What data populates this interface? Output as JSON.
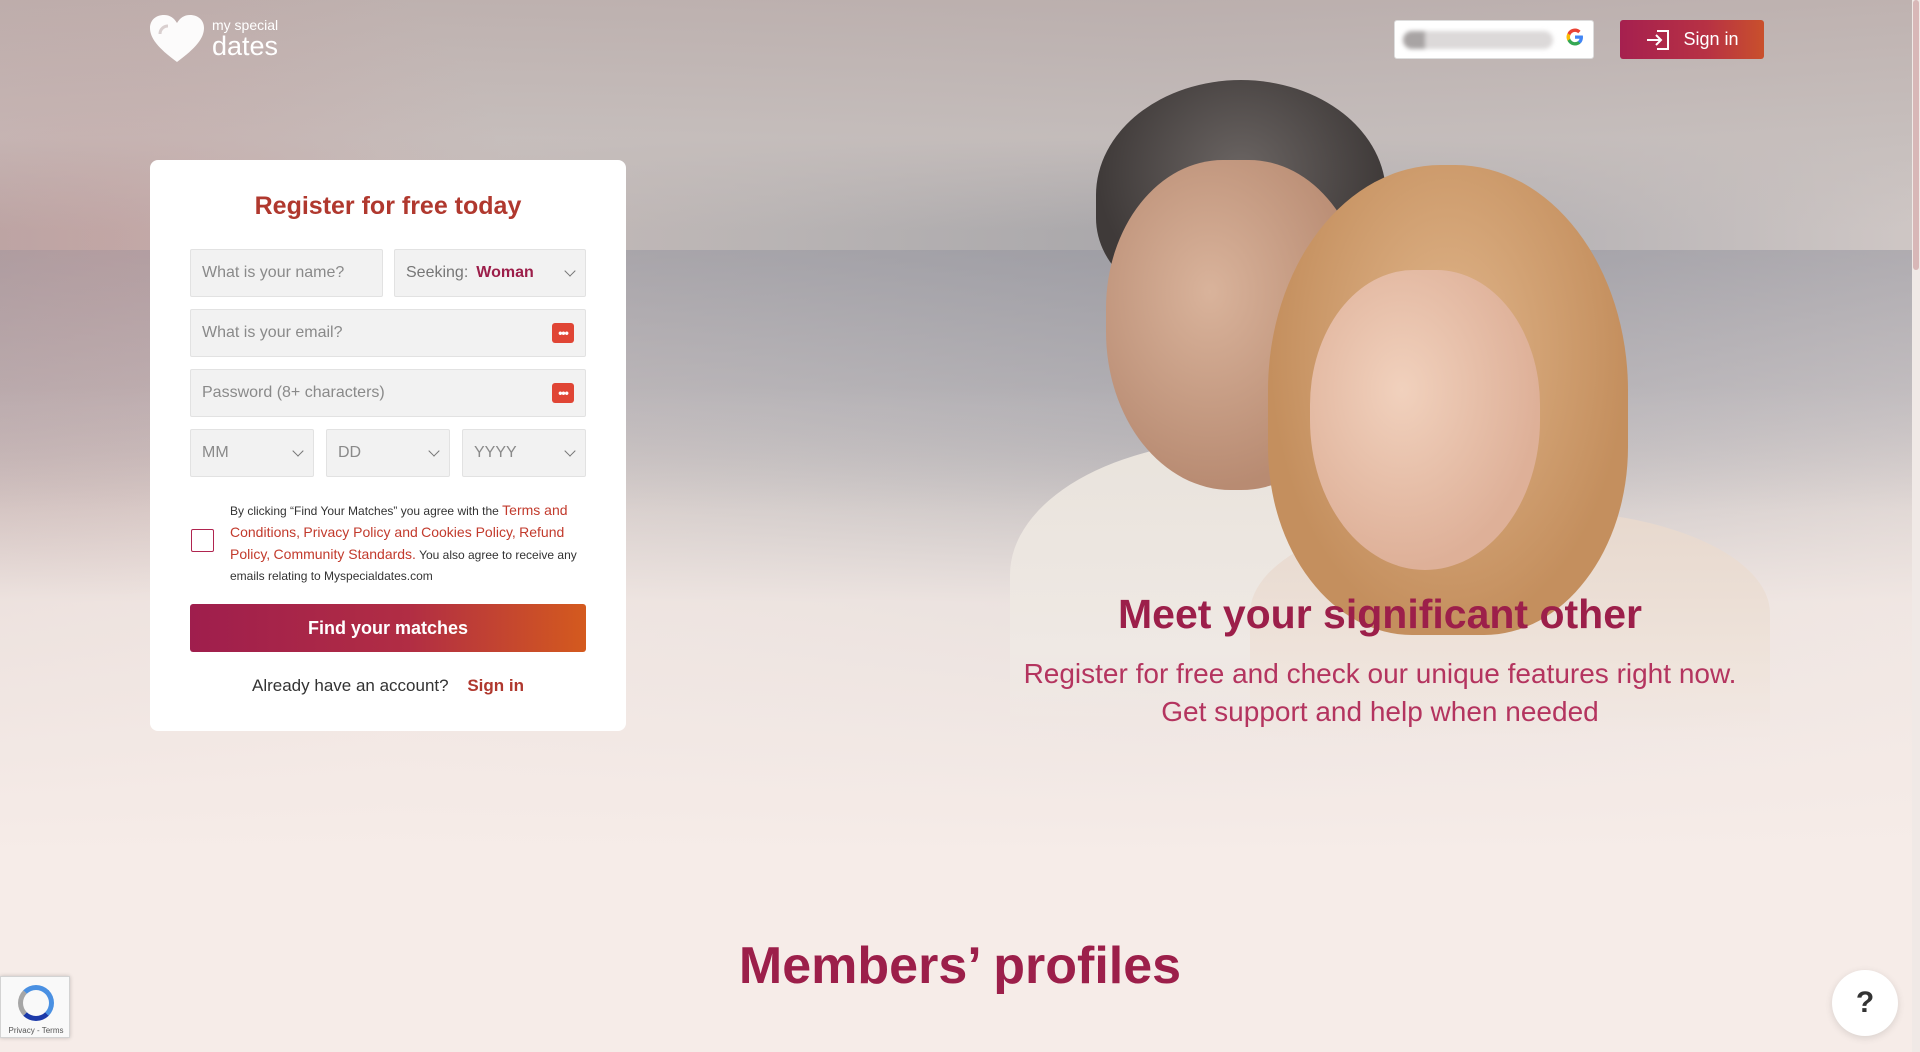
{
  "brand": {
    "small": "my special",
    "big": "dates"
  },
  "header": {
    "signin_label": "Sign in"
  },
  "register": {
    "title": "Register for free today",
    "name_placeholder": "What is your name?",
    "seeking_label": "Seeking:",
    "seeking_value": "Woman",
    "email_placeholder": "What is your email?",
    "password_placeholder": "Password (8+ characters)",
    "month_placeholder": "MM",
    "day_placeholder": "DD",
    "year_placeholder": "YYYY",
    "terms_prefix": "By clicking “Find Your Matches” you agree with the",
    "terms_link": "Terms and Conditions,",
    "privacy_link": "Privacy Policy and",
    "cookies_link": "Cookies Policy,",
    "refund_link": "Refund Policy,",
    "community_link": "Community Standards.",
    "terms_suffix": "You also agree to receive any emails relating to Myspecialdates.com",
    "submit_label": "Find your matches",
    "already_text": "Already have an account?",
    "signin_link": "Sign in"
  },
  "hero": {
    "title": "Meet your significant other",
    "subtitle_line1": "Register for free and check our unique features right now.",
    "subtitle_line2": "Get support and help when needed"
  },
  "members": {
    "title": "Members’ profiles"
  },
  "help": {
    "label": "?"
  },
  "recaptcha": {
    "links": "Privacy - Terms"
  },
  "colors": {
    "accent": "#9c1f4a",
    "orange": "#d45a1e",
    "link": "#c23a2c"
  }
}
